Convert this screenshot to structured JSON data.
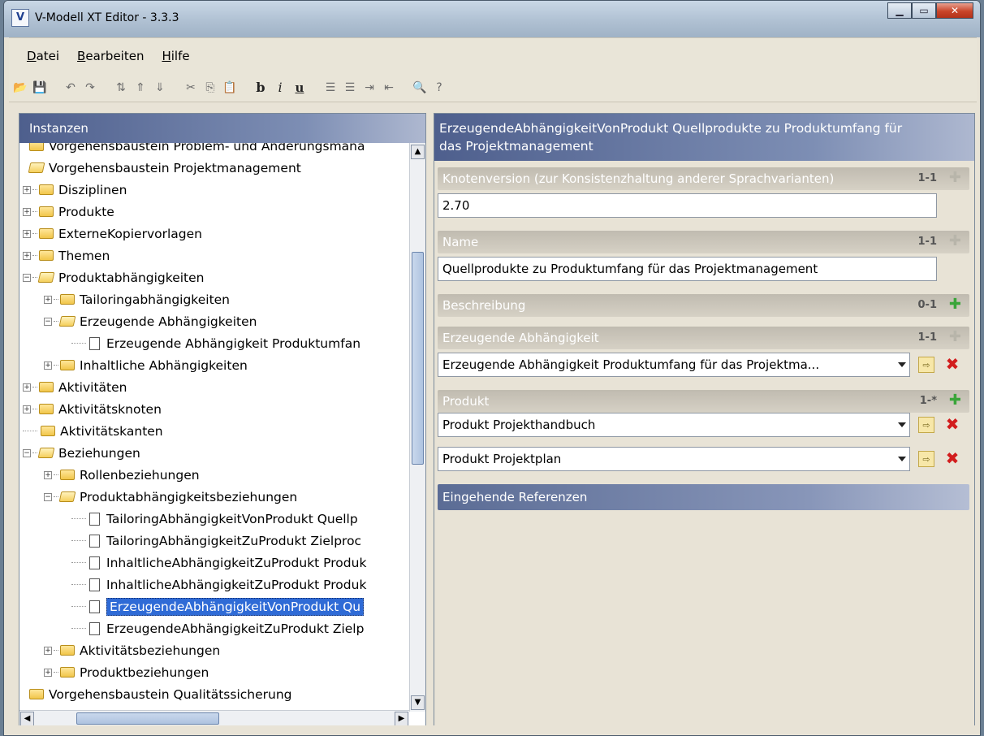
{
  "window": {
    "title": "V-Modell XT Editor - 3.3.3"
  },
  "menu": [
    {
      "label": "Datei",
      "mnemonic": "D",
      "rest": "atei"
    },
    {
      "label": "Bearbeiten",
      "mnemonic": "B",
      "rest": "earbeiten"
    },
    {
      "label": "Hilfe",
      "mnemonic": "H",
      "rest": "ilfe"
    }
  ],
  "left_panel": {
    "title": "Instanzen",
    "tree": [
      {
        "label": "Vorgehensbaustein Problem- und Änderungsmana",
        "level": 0,
        "icon": "folder"
      },
      {
        "label": "Vorgehensbaustein Projektmanagement",
        "level": 0,
        "icon": "folder-open"
      },
      {
        "label": "Disziplinen",
        "level": 1,
        "icon": "folder",
        "exp": "+"
      },
      {
        "label": "Produkte",
        "level": 1,
        "icon": "folder",
        "exp": "+"
      },
      {
        "label": "ExterneKopiervorlagen",
        "level": 1,
        "icon": "folder",
        "exp": "+"
      },
      {
        "label": "Themen",
        "level": 1,
        "icon": "folder",
        "exp": "+"
      },
      {
        "label": "Produktabhängigkeiten",
        "level": 1,
        "icon": "folder-open",
        "exp": "−"
      },
      {
        "label": "Tailoringabhängigkeiten",
        "level": 2,
        "icon": "folder",
        "exp": "+"
      },
      {
        "label": "Erzeugende Abhängigkeiten",
        "level": 2,
        "icon": "folder-open",
        "exp": "−"
      },
      {
        "label": "Erzeugende Abhängigkeit Produktumfan",
        "level": 3,
        "icon": "doc"
      },
      {
        "label": "Inhaltliche Abhängigkeiten",
        "level": 2,
        "icon": "folder",
        "exp": "+"
      },
      {
        "label": "Aktivitäten",
        "level": 1,
        "icon": "folder",
        "exp": "+"
      },
      {
        "label": "Aktivitätsknoten",
        "level": 1,
        "icon": "folder",
        "exp": "+"
      },
      {
        "label": "Aktivitätskanten",
        "level": 1,
        "icon": "folder"
      },
      {
        "label": "Beziehungen",
        "level": 1,
        "icon": "folder-open",
        "exp": "−"
      },
      {
        "label": "Rollenbeziehungen",
        "level": 2,
        "icon": "folder",
        "exp": "+"
      },
      {
        "label": "Produktabhängigkeitsbeziehungen",
        "level": 2,
        "icon": "folder-open",
        "exp": "−"
      },
      {
        "label": "TailoringAbhängigkeitVonProdukt Quellp",
        "level": 3,
        "icon": "doc"
      },
      {
        "label": "TailoringAbhängigkeitZuProdukt Zielproc",
        "level": 3,
        "icon": "doc"
      },
      {
        "label": "InhaltlicheAbhängigkeitZuProdukt Produk",
        "level": 3,
        "icon": "doc"
      },
      {
        "label": "InhaltlicheAbhängigkeitZuProdukt Produk",
        "level": 3,
        "icon": "doc"
      },
      {
        "label": "ErzeugendeAbhängigkeitVonProdukt Qu",
        "level": 3,
        "icon": "doc",
        "selected": true
      },
      {
        "label": "ErzeugendeAbhängigkeitZuProdukt Zielp",
        "level": 3,
        "icon": "doc"
      },
      {
        "label": "Aktivitätsbeziehungen",
        "level": 2,
        "icon": "folder",
        "exp": "+"
      },
      {
        "label": "Produktbeziehungen",
        "level": 2,
        "icon": "folder",
        "exp": "+"
      },
      {
        "label": "Vorgehensbaustein Qualitätssicherung",
        "level": 0,
        "icon": "folder"
      }
    ]
  },
  "right_panel": {
    "title_line1": "ErzeugendeAbhängigkeitVonProdukt Quellprodukte zu Produktumfang für",
    "title_line2": "das Projektmanagement",
    "knotenversion": {
      "label": "Knotenversion (zur Konsistenzhaltung anderer Sprachvarianten)",
      "card": "1-1",
      "value": "2.70"
    },
    "name": {
      "label": "Name",
      "card": "1-1",
      "value": "Quellprodukte zu Produktumfang für das Projektmanagement"
    },
    "beschreibung": {
      "label": "Beschreibung",
      "card": "0-1"
    },
    "erzeugende": {
      "label": "Erzeugende Abhängigkeit",
      "card": "1-1",
      "value": "Erzeugende Abhängigkeit Produktumfang für das Projektma..."
    },
    "produkt": {
      "label": "Produkt",
      "card": "1-*",
      "values": [
        "Produkt Projekthandbuch",
        "Produkt Projektplan"
      ]
    },
    "eingehende": {
      "label": "Eingehende Referenzen"
    }
  },
  "colors": {
    "selection": "#2f6bd6",
    "header_gradient_start": "#4e5f8d",
    "delete": "#d21d1d",
    "add": "#3aa53a"
  }
}
